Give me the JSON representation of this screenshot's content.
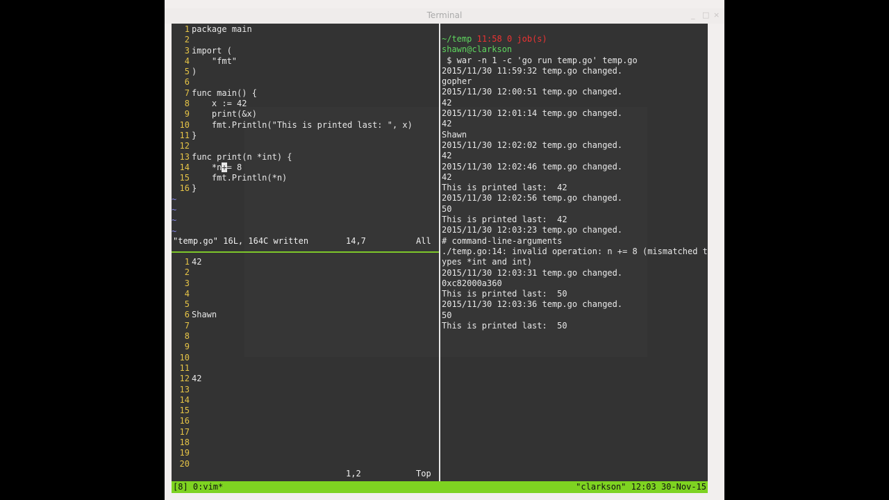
{
  "window": {
    "title": "Terminal",
    "buttons": [
      "_",
      "□",
      "×"
    ]
  },
  "vim_top": {
    "lines": [
      {
        "n": "1",
        "text": "package main"
      },
      {
        "n": "2",
        "text": ""
      },
      {
        "n": "3",
        "text": "import ("
      },
      {
        "n": "4",
        "text": "    \"fmt\""
      },
      {
        "n": "5",
        "text": ")"
      },
      {
        "n": "6",
        "text": ""
      },
      {
        "n": "7",
        "text": "func main() {"
      },
      {
        "n": "8",
        "text": "    x := 42"
      },
      {
        "n": "9",
        "text": "    print(&x)"
      },
      {
        "n": "10",
        "text": "    fmt.Println(\"This is printed last: \", x)"
      },
      {
        "n": "11",
        "text": "}"
      },
      {
        "n": "12",
        "text": ""
      },
      {
        "n": "13",
        "text": "func print(n *int) {"
      },
      {
        "n": "14a",
        "text": "    *n"
      },
      {
        "n": "14c",
        "text": "+"
      },
      {
        "n": "14b",
        "text": "= 8"
      },
      {
        "n": "15",
        "text": "    fmt.Println(*n)"
      },
      {
        "n": "16",
        "text": "}"
      }
    ],
    "line14_num": "14",
    "tilde": "~",
    "status_file": "\"temp.go\" 16L, 164C written",
    "status_pos": "14,7",
    "status_scroll": "All"
  },
  "vim_bottom": {
    "lines": [
      {
        "n": "1",
        "text": "42"
      },
      {
        "n": "2",
        "text": ""
      },
      {
        "n": "3",
        "text": ""
      },
      {
        "n": "4",
        "text": ""
      },
      {
        "n": "5",
        "text": ""
      },
      {
        "n": "6",
        "text": "Shawn"
      },
      {
        "n": "7",
        "text": ""
      },
      {
        "n": "8",
        "text": ""
      },
      {
        "n": "9",
        "text": ""
      },
      {
        "n": "10",
        "text": ""
      },
      {
        "n": "11",
        "text": ""
      },
      {
        "n": "12",
        "text": "42"
      },
      {
        "n": "13",
        "text": ""
      },
      {
        "n": "14",
        "text": ""
      },
      {
        "n": "15",
        "text": ""
      },
      {
        "n": "16",
        "text": ""
      },
      {
        "n": "17",
        "text": ""
      },
      {
        "n": "18",
        "text": ""
      },
      {
        "n": "19",
        "text": ""
      },
      {
        "n": "20",
        "text": ""
      }
    ],
    "status_pos": "1,2",
    "status_scroll": "Top"
  },
  "shell": {
    "cwd": "~/temp",
    "time_jobs": "11:58 0 job(s)",
    "user_host": "shawn@clarkson",
    "command": " $ war -n 1 -c 'go run temp.go' temp.go",
    "output": [
      "2015/11/30 11:59:32 temp.go changed.",
      "gopher",
      "2015/11/30 12:00:51 temp.go changed.",
      "42",
      "2015/11/30 12:01:14 temp.go changed.",
      "42",
      "Shawn",
      "2015/11/30 12:02:02 temp.go changed.",
      "42",
      "2015/11/30 12:02:46 temp.go changed.",
      "42",
      "This is printed last:  42",
      "2015/11/30 12:02:56 temp.go changed.",
      "50",
      "This is printed last:  42",
      "2015/11/30 12:03:23 temp.go changed.",
      "# command-line-arguments",
      "./temp.go:14: invalid operation: n += 8 (mismatched t",
      "ypes *int and int)",
      "2015/11/30 12:03:31 temp.go changed.",
      "0xc82000a360",
      "This is printed last:  50",
      "2015/11/30 12:03:36 temp.go changed.",
      "50",
      "This is printed last:  50"
    ]
  },
  "tmux": {
    "left": "[8] 0:vim*",
    "right": "\"clarkson\" 12:03 30-Nov-15"
  }
}
